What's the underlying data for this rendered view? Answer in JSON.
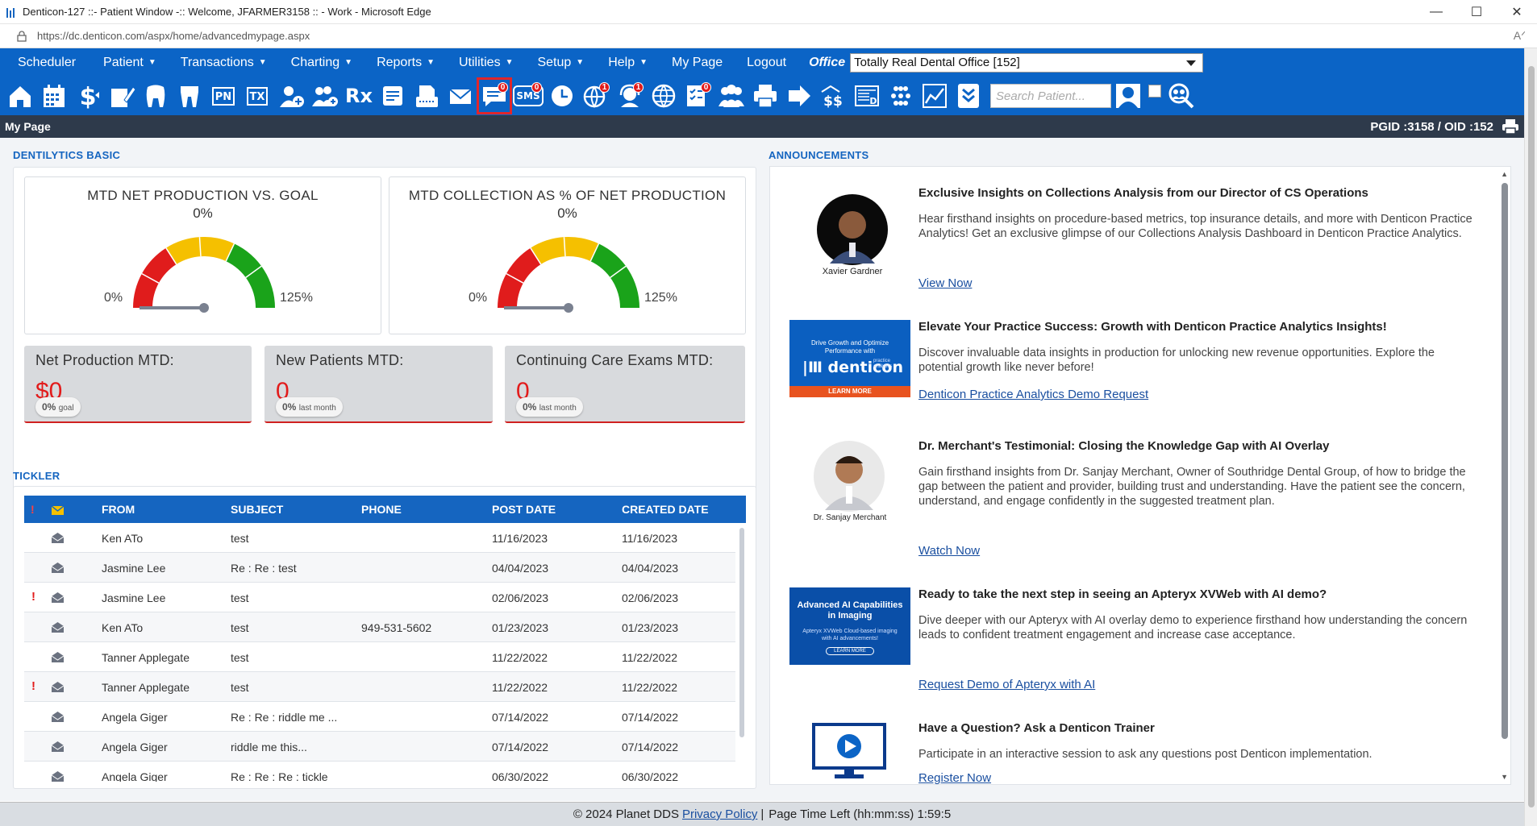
{
  "window": {
    "title": "Denticon-127 ::- Patient Window -:: Welcome, JFARMER3158 :: - Work - Microsoft Edge",
    "url": "https://dc.denticon.com/aspx/home/advancedmypage.aspx",
    "minimize": "—",
    "maximize": "☐",
    "close": "✕",
    "read_aloud": "Aᐟ"
  },
  "menu": {
    "items": [
      {
        "label": "Scheduler",
        "caret": false
      },
      {
        "label": "Patient",
        "caret": true
      },
      {
        "label": "Transactions",
        "caret": true
      },
      {
        "label": "Charting",
        "caret": true
      },
      {
        "label": "Reports",
        "caret": true
      },
      {
        "label": "Utilities",
        "caret": true
      },
      {
        "label": "Setup",
        "caret": true
      },
      {
        "label": "Help",
        "caret": true
      },
      {
        "label": "My Page",
        "caret": false
      },
      {
        "label": "Logout",
        "caret": false
      }
    ],
    "caret_glyph": "▼",
    "office_label": "Office",
    "office_value": "Totally Real Dental Office [152]"
  },
  "toolbar": {
    "search_placeholder": "Search Patient...",
    "icons": [
      {
        "name": "home-icon"
      },
      {
        "name": "calendar-icon"
      },
      {
        "name": "dollar-icon"
      },
      {
        "name": "clipboard-edit-icon"
      },
      {
        "name": "tooth-icon"
      },
      {
        "name": "tooth-chart-icon"
      },
      {
        "name": "pn-icon",
        "text": "PN"
      },
      {
        "name": "tx-icon",
        "text": "TX"
      },
      {
        "name": "add-patient-icon"
      },
      {
        "name": "add-family-icon"
      },
      {
        "name": "rx-icon",
        "text": "Rx"
      },
      {
        "name": "notes-icon"
      },
      {
        "name": "fax-icon"
      },
      {
        "name": "mail-icon"
      },
      {
        "name": "message-icon",
        "badge": "0",
        "active": true
      },
      {
        "name": "sms-icon",
        "text": "SMS",
        "badge": "0"
      },
      {
        "name": "clock-icon"
      },
      {
        "name": "globe-alert-icon",
        "badge": "1"
      },
      {
        "name": "support-icon",
        "badge": "1"
      },
      {
        "name": "network-globe-icon"
      },
      {
        "name": "checklist-icon",
        "badge": "0"
      },
      {
        "name": "group-icon"
      },
      {
        "name": "printer-icon"
      },
      {
        "name": "arrow-right-icon"
      },
      {
        "name": "billing-icon"
      },
      {
        "name": "statement-icon"
      },
      {
        "name": "apps-icon"
      },
      {
        "name": "line-chart-icon"
      },
      {
        "name": "double-chevron-down-icon"
      }
    ]
  },
  "page_header": {
    "title": "My Page",
    "pgid": "PGID :3158  /  OID :152"
  },
  "dentilytics": {
    "section_title": "DENTILYTICS BASIC",
    "gauges": [
      {
        "title": "MTD NET PRODUCTION VS. GOAL",
        "value": "0%",
        "value_num": 0,
        "min": "0%",
        "max": "125%"
      },
      {
        "title": "MTD COLLECTION AS % OF NET PRODUCTION",
        "value": "0%",
        "value_num": 0,
        "min": "0%",
        "max": "125%"
      }
    ],
    "kpis": [
      {
        "title": "Net Production MTD:",
        "value": "$0",
        "pct": "0%",
        "pct_label": "goal"
      },
      {
        "title": "New Patients MTD:",
        "value": "0",
        "pct": "0%",
        "pct_label": "last month"
      },
      {
        "title": "Continuing Care Exams MTD:",
        "value": "0",
        "pct": "0%",
        "pct_label": "last month"
      }
    ]
  },
  "tickler": {
    "section_title": "TICKLER",
    "columns": {
      "priority": "!",
      "from": "FROM",
      "subject": "SUBJECT",
      "phone": "PHONE",
      "post_date": "POST DATE",
      "created_date": "CREATED DATE"
    },
    "rows": [
      {
        "priority": "",
        "from": "Ken ATo",
        "subject": "test",
        "phone": "",
        "post": "11/16/2023",
        "created": "11/16/2023"
      },
      {
        "priority": "",
        "from": "Jasmine Lee",
        "subject": "Re : Re : test",
        "phone": "",
        "post": "04/04/2023",
        "created": "04/04/2023"
      },
      {
        "priority": "!",
        "from": "Jasmine Lee",
        "subject": "test",
        "phone": "",
        "post": "02/06/2023",
        "created": "02/06/2023"
      },
      {
        "priority": "",
        "from": "Ken ATo",
        "subject": "test",
        "phone": "949-531-5602",
        "post": "01/23/2023",
        "created": "01/23/2023"
      },
      {
        "priority": "",
        "from": "Tanner Applegate",
        "subject": "test",
        "phone": "",
        "post": "11/22/2022",
        "created": "11/22/2022"
      },
      {
        "priority": "!",
        "from": "Tanner Applegate",
        "subject": "test",
        "phone": "",
        "post": "11/22/2022",
        "created": "11/22/2022"
      },
      {
        "priority": "",
        "from": "Angela Giger",
        "subject": "Re : Re : riddle me ...",
        "phone": "",
        "post": "07/14/2022",
        "created": "07/14/2022"
      },
      {
        "priority": "",
        "from": "Angela Giger",
        "subject": "riddle me this...",
        "phone": "",
        "post": "07/14/2022",
        "created": "07/14/2022"
      },
      {
        "priority": "",
        "from": "Angela Giger",
        "subject": "Re : Re : Re : tickle",
        "phone": "",
        "post": "06/30/2022",
        "created": "06/30/2022"
      }
    ]
  },
  "announcements": {
    "section_title": "ANNOUNCEMENTS",
    "items": [
      {
        "heading": "Exclusive Insights on Collections Analysis from our Director of CS Operations",
        "body": "Hear firsthand insights on procedure-based metrics, top insurance details, and more with Denticon Practice Analytics! Get an exclusive glimpse of our Collections Analysis Dashboard in Denticon Practice Analytics.",
        "link": "View Now",
        "image_caption": "Xavier Gardner",
        "image": "portrait"
      },
      {
        "heading": "Elevate Your Practice Success: Growth with Denticon Practice Analytics Insights!",
        "body": "Discover invaluable data insights in production for unlocking new revenue opportunities. Explore the potential growth like never before!",
        "link": "Denticon Practice Analytics Demo Request",
        "banner_top": "Drive Growth and Optimize Performance with",
        "banner_brand": "denticon",
        "banner_sub": "practice analytics",
        "banner_cta": "LEARN MORE"
      },
      {
        "heading": "Dr. Merchant's Testimonial: Closing the Knowledge Gap with AI Overlay",
        "body": "Gain firsthand insights from Dr. Sanjay Merchant, Owner of Southridge Dental Group, of how to bridge the gap between the patient and provider, building trust and understanding. Have the patient see the concern, understand, and engage confidently in the suggested treatment plan.",
        "link": "Watch Now",
        "image_caption": "Dr. Sanjay Merchant",
        "image": "portrait"
      },
      {
        "heading": "Ready to take the next step in seeing an Apteryx XVWeb with AI demo?",
        "body": "Dive deeper with our Apteryx with AI overlay demo to experience firsthand how understanding the concern leads to confident treatment engagement and increase case acceptance.",
        "link": "Request Demo of Apteryx with AI",
        "banner_top": "Advanced AI Capabilities in Imaging",
        "banner_sub": "Apteryx XVWeb Cloud-based imaging with AI advancements!",
        "banner_cta": "LEARN MORE"
      },
      {
        "heading": "Have a Question? Ask a Denticon Trainer",
        "body": "Participate in an interactive session to ask any questions post Denticon implementation.",
        "link": "Register Now"
      }
    ]
  },
  "footer": {
    "copyright": "© 2024 Planet DDS",
    "privacy": "Privacy Policy",
    "separator": "|",
    "time_left": "Page Time Left (hh:mm:ss) 1:59:5"
  },
  "colors": {
    "brand_blue": "#0b64c6",
    "header_dark": "#2e3a4b",
    "gauge_red": "#e01c1c",
    "gauge_yellow": "#f5c000",
    "gauge_green": "#1aa31a",
    "accent_red": "#e21b1b"
  }
}
